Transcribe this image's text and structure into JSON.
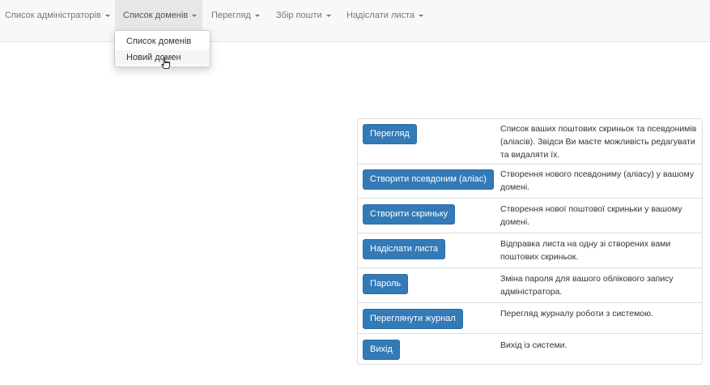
{
  "navbar": {
    "items": [
      {
        "label": "Список адміністраторів"
      },
      {
        "label": "Список доменів"
      },
      {
        "label": "Перегляд"
      },
      {
        "label": "Збір пошти"
      },
      {
        "label": "Надіслати листа"
      }
    ],
    "dropdown": {
      "items": [
        {
          "label": "Список доменів"
        },
        {
          "label": "Новий домен"
        }
      ]
    }
  },
  "actions": [
    {
      "button": "Перегляд",
      "description": "Список ваших поштових скриньок та псевдонимів (аліасів). Звідси Ви маєте можливість редагувати та видаляти їх."
    },
    {
      "button": "Створити псевдоним (аліас)",
      "description": "Створення нового псевдониму (аліасу) у вашому домені."
    },
    {
      "button": "Створити скриньку",
      "description": "Створення нової поштової скриньки у вашому домені."
    },
    {
      "button": "Надіслати листа",
      "description": "Відправка листа на одну зі створених вами поштових скриньок."
    },
    {
      "button": "Пароль",
      "description": "Зміна пароля для вашого облікового запису адміністратора."
    },
    {
      "button": "Переглянути журнал",
      "description": "Перегляд журналу роботи з системою."
    },
    {
      "button": "Вихід",
      "description": "Вихід із системи."
    }
  ]
}
